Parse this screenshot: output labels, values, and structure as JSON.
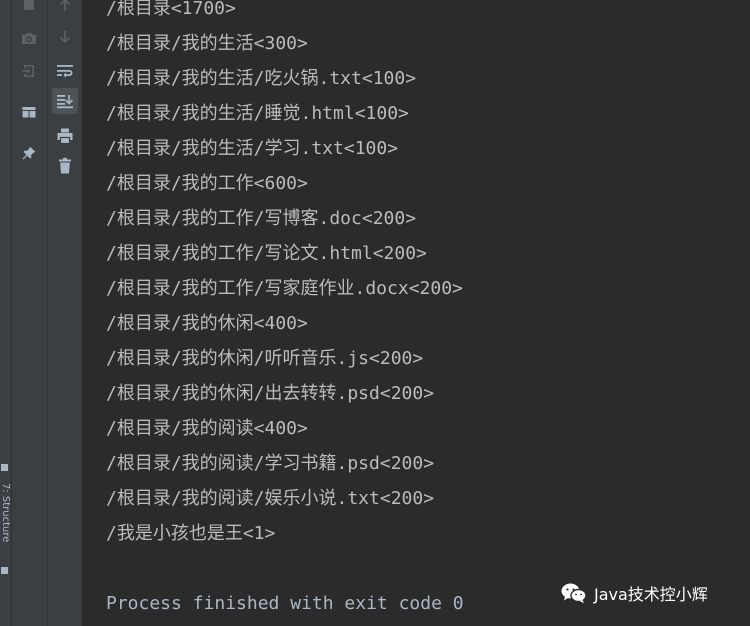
{
  "side_strip": {
    "label": "7: Structure"
  },
  "toolbar_left": [
    {
      "icon": "stop-icon"
    },
    {
      "icon": "camera-icon"
    },
    {
      "icon": "login-icon"
    },
    {
      "icon": "layout-icon"
    },
    {
      "icon": "pin-icon"
    }
  ],
  "toolbar_right": [
    {
      "icon": "up-arrow-icon"
    },
    {
      "icon": "down-arrow-icon"
    },
    {
      "icon": "soft-wrap-icon"
    },
    {
      "icon": "scroll-to-end-icon",
      "active": true
    },
    {
      "icon": "print-icon"
    },
    {
      "icon": "trash-icon"
    }
  ],
  "console": {
    "lines": [
      "/根目录<1700>",
      "/根目录/我的生活<300>",
      "/根目录/我的生活/吃火锅.txt<100>",
      "/根目录/我的生活/睡觉.html<100>",
      "/根目录/我的生活/学习.txt<100>",
      "/根目录/我的工作<600>",
      "/根目录/我的工作/写博客.doc<200>",
      "/根目录/我的工作/写论文.html<200>",
      "/根目录/我的工作/写家庭作业.docx<200>",
      "/根目录/我的休闲<400>",
      "/根目录/我的休闲/听听音乐.js<200>",
      "/根目录/我的休闲/出去转转.psd<200>",
      "/根目录/我的阅读<400>",
      "/根目录/我的阅读/学习书籍.psd<200>",
      "/根目录/我的阅读/娱乐小说.txt<200>",
      "/我是小孩也是王<1>"
    ],
    "process_message": "Process finished with exit code 0"
  },
  "watermark": {
    "text": "Java技术控小辉",
    "icon": "wechat-icon"
  },
  "colors": {
    "console_bg": "#2b2b2b",
    "toolbar_bg": "#3c3f41",
    "text": "#bbbbbb",
    "icon": "#a9b7c6"
  }
}
